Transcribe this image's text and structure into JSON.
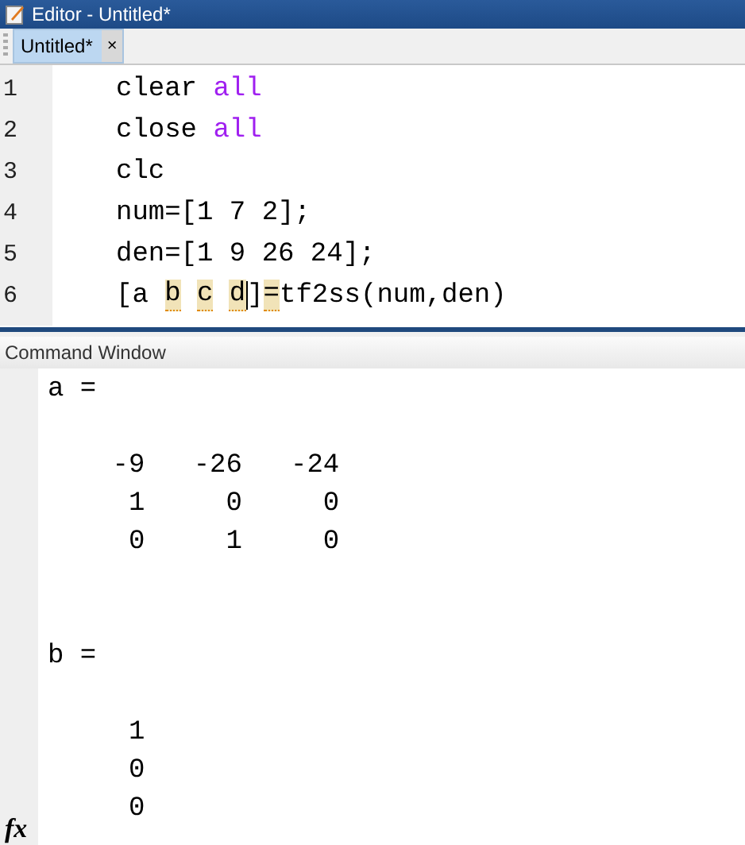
{
  "window": {
    "title": "Editor - Untitled*"
  },
  "tabs": [
    {
      "label": "Untitled*",
      "selected": true,
      "close": "×"
    }
  ],
  "editor": {
    "lines": [
      {
        "number": "1",
        "tokens": [
          {
            "kind": "plain",
            "text": "clear "
          },
          {
            "kind": "keyword",
            "text": "all"
          }
        ]
      },
      {
        "number": "2",
        "tokens": [
          {
            "kind": "plain",
            "text": "close "
          },
          {
            "kind": "keyword",
            "text": "all"
          }
        ]
      },
      {
        "number": "3",
        "tokens": [
          {
            "kind": "plain",
            "text": "clc"
          }
        ]
      },
      {
        "number": "4",
        "tokens": [
          {
            "kind": "plain",
            "text": "num=[1 7 2];"
          }
        ]
      },
      {
        "number": "5",
        "tokens": [
          {
            "kind": "plain",
            "text": "den=[1 9 26 24];"
          }
        ]
      },
      {
        "number": "6",
        "tokens": [
          {
            "kind": "plain",
            "text": "[a "
          },
          {
            "kind": "flagged",
            "text": "b"
          },
          {
            "kind": "flagged",
            "text": "c"
          },
          {
            "kind": "flagged",
            "text": "d",
            "cursor": true
          },
          {
            "kind": "plain",
            "text": "]"
          },
          {
            "kind": "flagged",
            "text": "="
          },
          {
            "kind": "plain",
            "text": "tf2ss(num,den)"
          }
        ]
      }
    ]
  },
  "command_window": {
    "title": "Command Window",
    "prompt": "fx",
    "outputs": [
      {
        "name": "a =",
        "rows": [
          "    -9   -26   -24",
          "     1     0     0",
          "     0     1     0"
        ]
      },
      {
        "name": "b =",
        "rows": [
          "     1",
          "     0",
          "     0"
        ]
      }
    ]
  }
}
